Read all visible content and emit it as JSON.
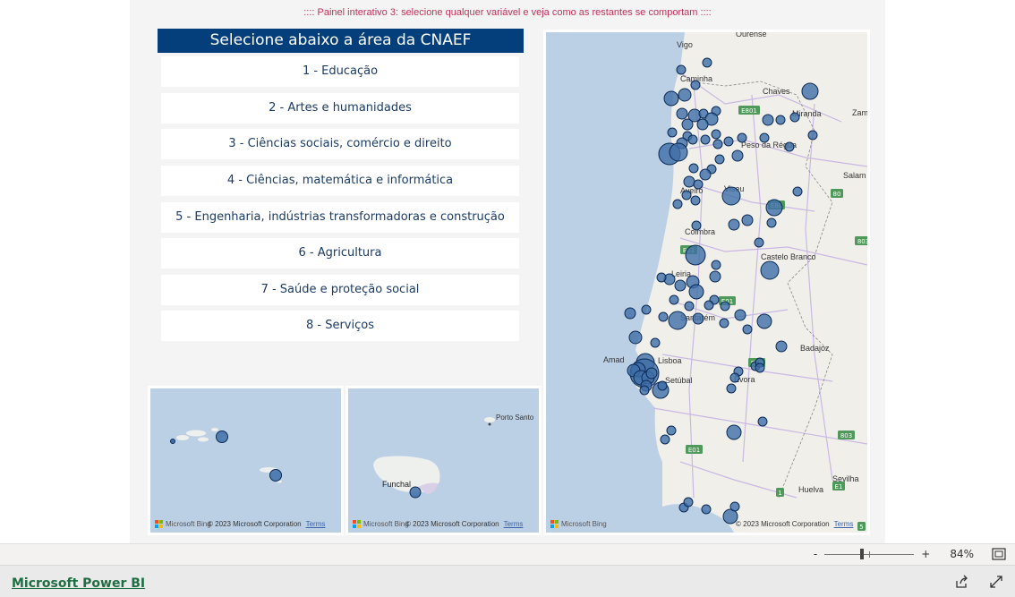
{
  "report": {
    "subtitle": ":::: Painel interativo 3: selecione qualquer variável e veja como as restantes se comportam ::::",
    "header": "Selecione abaixo a área da CNAEF",
    "cnaef_options": [
      "1 - Educação",
      "2 - Artes e humanidades",
      "3 - Ciências sociais, comércio e direito",
      "4 - Ciências, matemática e informática",
      "5 - Engenharia, indústrias transformadoras e construção",
      "6 - Agricultura",
      "7 - Saúde e proteção social",
      "8 - Serviços"
    ]
  },
  "maps": {
    "bing_label": "Microsoft Bing",
    "copyright": "© 2023 Microsoft Corporation",
    "terms": "Terms",
    "azores": {
      "places": []
    },
    "madeira": {
      "places": [
        "Funchal",
        "Porto Santo"
      ]
    },
    "mainland": {
      "places": [
        "Vigo",
        "Ourense",
        "Caminha",
        "Chaves",
        "Miranda",
        "Zam",
        "Peso da Régua",
        "Viseu",
        "Salam",
        "Aveiro",
        "Coimbra",
        "Castelo Branco",
        "Leiria",
        "Santarém",
        "Amad",
        "Lisboa",
        "Setúbal",
        "Badajoz",
        "Évora",
        "Sevilha",
        "Huelva"
      ],
      "road_labels": [
        "E801",
        "E80",
        "80",
        "E01",
        "803",
        "E01",
        "E90",
        "E01",
        "803",
        "E1",
        "1",
        "5"
      ]
    },
    "bubble_color": "#1d4e89"
  },
  "statusbar": {
    "zoom_minus": "-",
    "zoom_plus": "+",
    "zoom_level": "84%",
    "zoom_value": 84
  },
  "footer": {
    "brand": "Microsoft Power BI"
  }
}
